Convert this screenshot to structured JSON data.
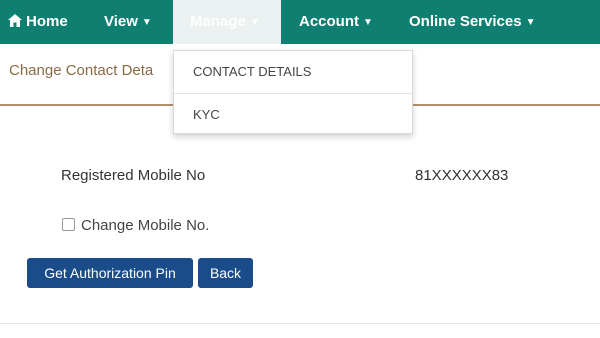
{
  "nav": {
    "home": "Home",
    "view": "View",
    "manage": "Manage",
    "account": "Account",
    "online_services": "Online Services",
    "caret": "▼",
    "home_icon": "home-icon",
    "bar_color": "#0f7f72"
  },
  "dropdown": {
    "items": [
      "CONTACT DETAILS",
      "KYC"
    ]
  },
  "page": {
    "title": "Change Contact Deta"
  },
  "form": {
    "registered_label": "Registered Mobile No",
    "registered_value": "81XXXXXX83",
    "checkbox_label": "Change Mobile No.",
    "checkbox_checked": false,
    "auth_button": "Get Authorization Pin",
    "back_button": "Back",
    "button_color": "#1a4c8a"
  }
}
